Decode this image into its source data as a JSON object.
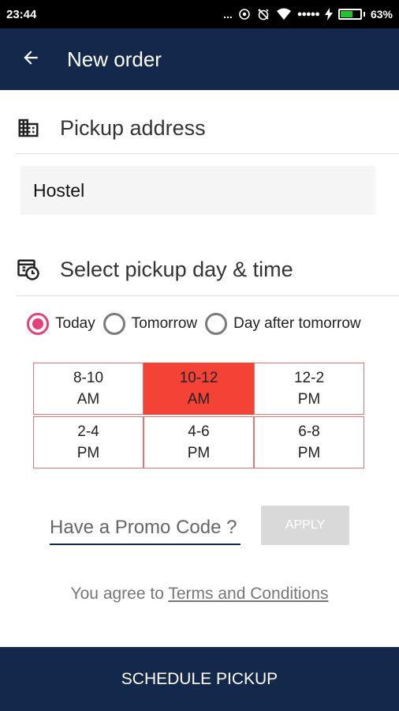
{
  "status_bar": {
    "time": "23:44",
    "dots": "...",
    "signal_dots": "●●●●●",
    "battery_percent": "63%",
    "battery_level": 0.63,
    "icons": [
      "nfc-icon",
      "alarm-off-icon",
      "wifi-icon",
      "charging-icon"
    ]
  },
  "app_bar": {
    "title": "New order",
    "back_icon": "arrow-left-icon"
  },
  "pickup_section": {
    "icon": "building-icon",
    "label": "Pickup address",
    "address_value": "Hostel"
  },
  "schedule_section": {
    "icon": "calendar-clock-icon",
    "label": "Select pickup day & time",
    "day_options": [
      {
        "label": "Today",
        "selected": true
      },
      {
        "label": "Tomorrow",
        "selected": false
      },
      {
        "label": "Day after tomorrow",
        "selected": false
      }
    ],
    "time_slots": [
      [
        {
          "range": "8-10",
          "period": "AM",
          "selected": false
        },
        {
          "range": "10-12",
          "period": "AM",
          "selected": true
        },
        {
          "range": "12-2",
          "period": "PM",
          "selected": false
        }
      ],
      [
        {
          "range": "2-4",
          "period": "PM",
          "selected": false
        },
        {
          "range": "4-6",
          "period": "PM",
          "selected": false
        },
        {
          "range": "6-8",
          "period": "PM",
          "selected": false
        }
      ]
    ]
  },
  "promo": {
    "placeholder": "Have a Promo Code ?",
    "value": "",
    "apply_label": "APPLY"
  },
  "terms": {
    "prefix": "You agree to ",
    "link_label": "Terms and Conditions"
  },
  "footer": {
    "schedule_label": "SCHEDULE PICKUP"
  },
  "colors": {
    "primary": "#14284b",
    "accent": "#e5407c",
    "selected_slot": "#f44336",
    "slot_border": "#e57373"
  }
}
